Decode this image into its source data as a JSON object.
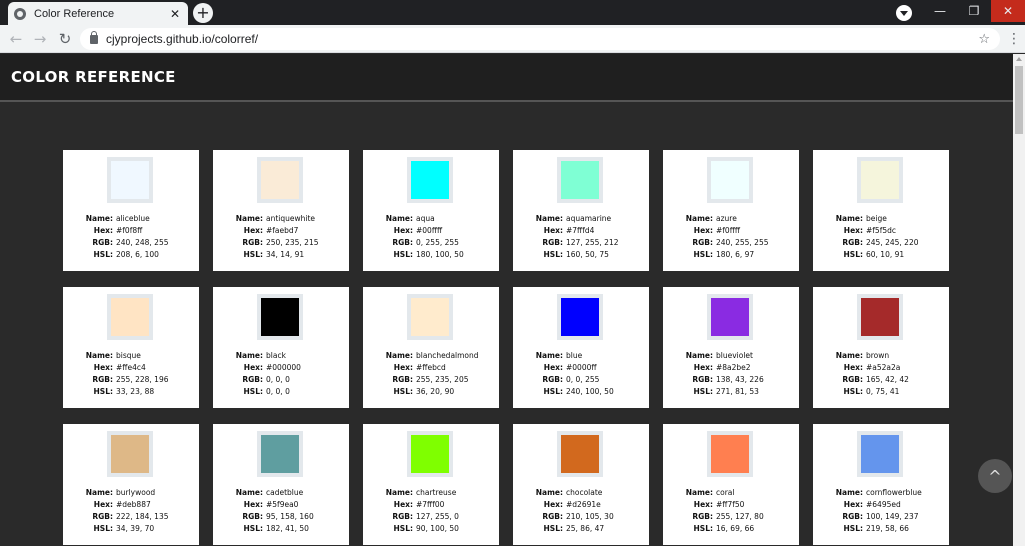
{
  "browser": {
    "tab_title": "Color Reference",
    "tab_close": "✕",
    "new_tab": "+",
    "url": "cjyprojects.github.io/colorref/",
    "win_min": "—",
    "win_max": "❐",
    "win_close": "✕"
  },
  "page": {
    "title": "COLOR REFERENCE",
    "labels": {
      "name": "Name:",
      "hex": "Hex:",
      "rgb": "RGB:",
      "hsl": "HSL:"
    },
    "scroll_top": "^"
  },
  "colors": [
    {
      "name": "aliceblue",
      "hex": "#f0f8ff",
      "rgb": "240, 248, 255",
      "hsl": "208, 6, 100"
    },
    {
      "name": "antiquewhite",
      "hex": "#faebd7",
      "rgb": "250, 235, 215",
      "hsl": "34, 14, 91"
    },
    {
      "name": "aqua",
      "hex": "#00ffff",
      "rgb": "0, 255, 255",
      "hsl": "180, 100, 50"
    },
    {
      "name": "aquamarine",
      "hex": "#7fffd4",
      "rgb": "127, 255, 212",
      "hsl": "160, 50, 75"
    },
    {
      "name": "azure",
      "hex": "#f0ffff",
      "rgb": "240, 255, 255",
      "hsl": "180, 6, 97"
    },
    {
      "name": "beige",
      "hex": "#f5f5dc",
      "rgb": "245, 245, 220",
      "hsl": "60, 10, 91"
    },
    {
      "name": "bisque",
      "hex": "#ffe4c4",
      "rgb": "255, 228, 196",
      "hsl": "33, 23, 88"
    },
    {
      "name": "black",
      "hex": "#000000",
      "rgb": "0, 0, 0",
      "hsl": "0, 0, 0"
    },
    {
      "name": "blanchedalmond",
      "hex": "#ffebcd",
      "rgb": "255, 235, 205",
      "hsl": "36, 20, 90"
    },
    {
      "name": "blue",
      "hex": "#0000ff",
      "rgb": "0, 0, 255",
      "hsl": "240, 100, 50"
    },
    {
      "name": "blueviolet",
      "hex": "#8a2be2",
      "rgb": "138, 43, 226",
      "hsl": "271, 81, 53"
    },
    {
      "name": "brown",
      "hex": "#a52a2a",
      "rgb": "165, 42, 42",
      "hsl": "0, 75, 41"
    },
    {
      "name": "burlywood",
      "hex": "#deb887",
      "rgb": "222, 184, 135",
      "hsl": "34, 39, 70"
    },
    {
      "name": "cadetblue",
      "hex": "#5f9ea0",
      "rgb": "95, 158, 160",
      "hsl": "182, 41, 50"
    },
    {
      "name": "chartreuse",
      "hex": "#7fff00",
      "rgb": "127, 255, 0",
      "hsl": "90, 100, 50"
    },
    {
      "name": "chocolate",
      "hex": "#d2691e",
      "rgb": "210, 105, 30",
      "hsl": "25, 86, 47"
    },
    {
      "name": "coral",
      "hex": "#ff7f50",
      "rgb": "255, 127, 80",
      "hsl": "16, 69, 66"
    },
    {
      "name": "cornflowerblue",
      "hex": "#6495ed",
      "rgb": "100, 149, 237",
      "hsl": "219, 58, 66"
    }
  ]
}
